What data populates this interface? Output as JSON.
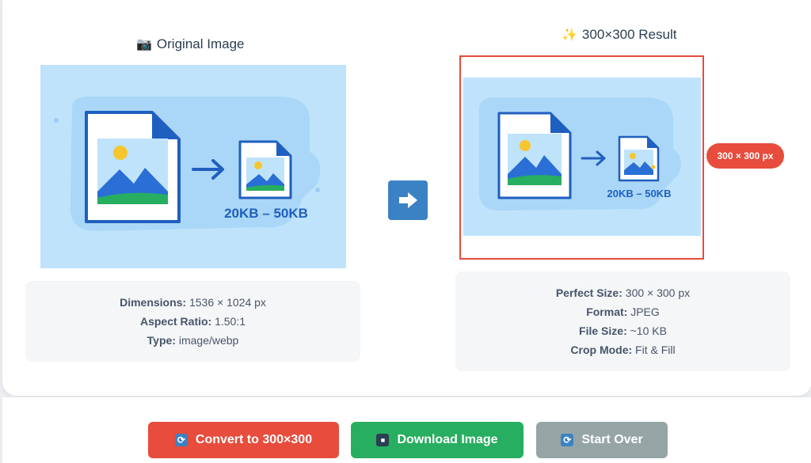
{
  "original": {
    "icon": "camera-icon",
    "icon_glyph": "📷",
    "title": "Original Image",
    "illustration_label": "20KB – 50KB",
    "info": [
      {
        "key": "Dimensions:",
        "value": "1536 × 1024 px"
      },
      {
        "key": "Aspect Ratio:",
        "value": "1.50:1"
      },
      {
        "key": "Type:",
        "value": "image/webp"
      }
    ]
  },
  "result": {
    "icon": "sparkles-icon",
    "icon_glyph": "✨",
    "title": "300×300 Result",
    "illustration_label": "20KB – 50KB",
    "size_badge": "300 × 300 px",
    "info": [
      {
        "key": "Perfect Size:",
        "value": "300 × 300 px"
      },
      {
        "key": "Format:",
        "value": "JPEG"
      },
      {
        "key": "File Size:",
        "value": "~10 KB"
      },
      {
        "key": "Crop Mode:",
        "value": "Fit & Fill"
      }
    ]
  },
  "buttons": {
    "convert": {
      "icon": "refresh-icon",
      "label": "Convert to 300×300"
    },
    "download": {
      "icon": "save-disk-icon",
      "label": "Download Image"
    },
    "start_over": {
      "icon": "refresh-icon",
      "label": "Start Over"
    }
  },
  "colors": {
    "accent_red": "#e74c3c",
    "accent_green": "#27ae60",
    "accent_gray": "#95a5a6",
    "accent_blue": "#3b82c4",
    "illustration_bg": "#bfe3fb"
  }
}
